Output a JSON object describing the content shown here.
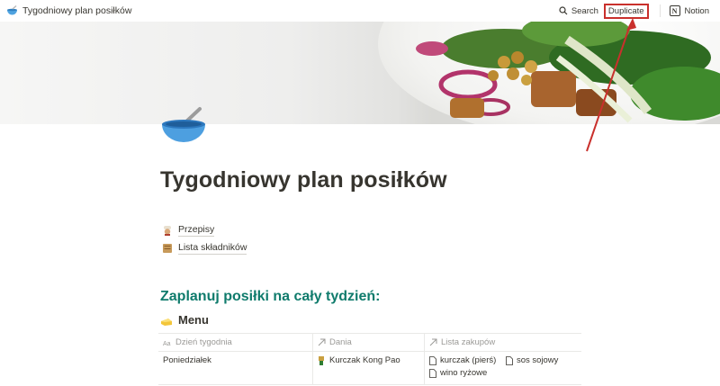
{
  "topbar": {
    "page_title": "Tygodniowy plan posiłków",
    "search_label": "Search",
    "duplicate_label": "Duplicate",
    "notion_label": "Notion"
  },
  "page": {
    "title": "Tygodniowy plan posiłków",
    "links": [
      {
        "label": "Przepisy",
        "icon": "chef-emoji"
      },
      {
        "label": "Lista składników",
        "icon": "scroll-emoji"
      }
    ],
    "section_heading": "Zaplanuj posiłki na cały tydzień:",
    "menu_heading": "Menu",
    "menu_icon": "butter-emoji"
  },
  "table": {
    "columns": [
      "Dzień tygodnia",
      "Dania",
      "Lista zakupów"
    ],
    "rows": [
      {
        "day": "Poniedziałek",
        "dish": "Kurczak Kong Pao",
        "shopping": [
          "kurczak (pierś)",
          "sos sojowy",
          "wino ryżowe"
        ]
      }
    ]
  },
  "colors": {
    "heading_green": "#0f7b6c",
    "highlight_red": "#c9302c",
    "text": "#37352f",
    "muted": "#9b9a97"
  }
}
